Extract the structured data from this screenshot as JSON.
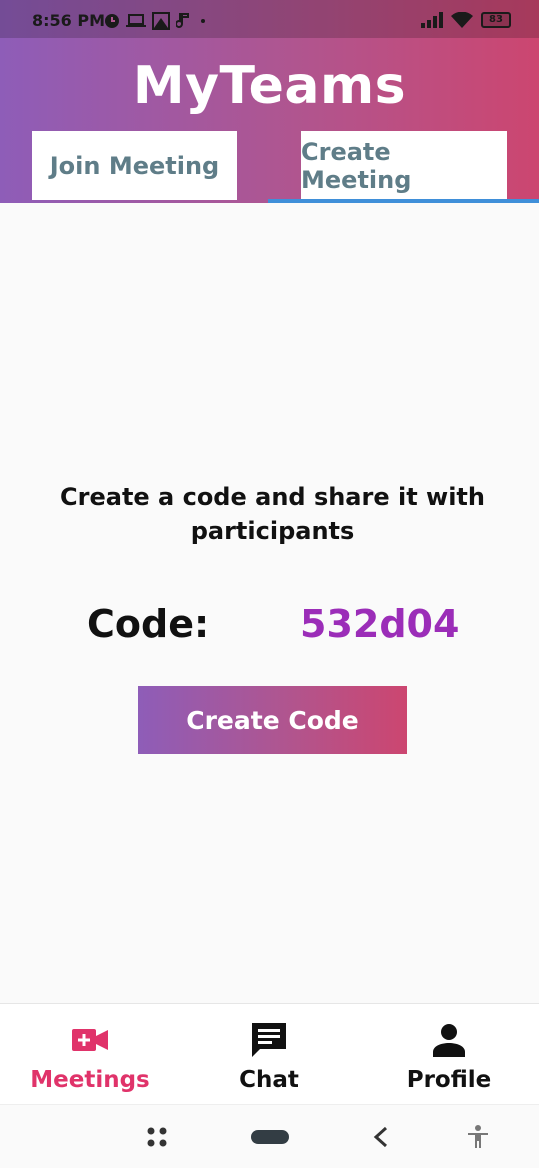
{
  "status_bar": {
    "time": "8:56 PM",
    "notification_icons": [
      "clock-icon",
      "laptop-icon",
      "image-icon",
      "music-icon",
      "dot-icon"
    ],
    "signal_icon": "signal-icon",
    "wifi_icon": "wifi-icon",
    "battery": "83"
  },
  "header": {
    "app_title": "MyTeams",
    "tabs": [
      {
        "label": "Join Meeting",
        "selected": false
      },
      {
        "label": "Create Meeting",
        "selected": true
      }
    ]
  },
  "main": {
    "prompt": "Create a code and share it with participants",
    "code_label": "Code:",
    "code_value": "532d04",
    "create_button_label": "Create Code"
  },
  "bottom_nav": {
    "items": [
      {
        "label": "Meetings",
        "icon": "video-add-icon",
        "active": true
      },
      {
        "label": "Chat",
        "icon": "chat-icon",
        "active": false
      },
      {
        "label": "Profile",
        "icon": "person-icon",
        "active": false
      }
    ]
  },
  "system_nav": {
    "icons": [
      "apps-icon",
      "home-pill-icon",
      "back-icon",
      "accessibility-icon"
    ]
  },
  "colors": {
    "gradient_start": "#8e5db8",
    "gradient_end": "#cc4670",
    "code_value": "#9b2db8",
    "active_nav": "#e0336a",
    "tab_text": "#5f7d88",
    "tab_indicator": "#3f8fd9"
  }
}
